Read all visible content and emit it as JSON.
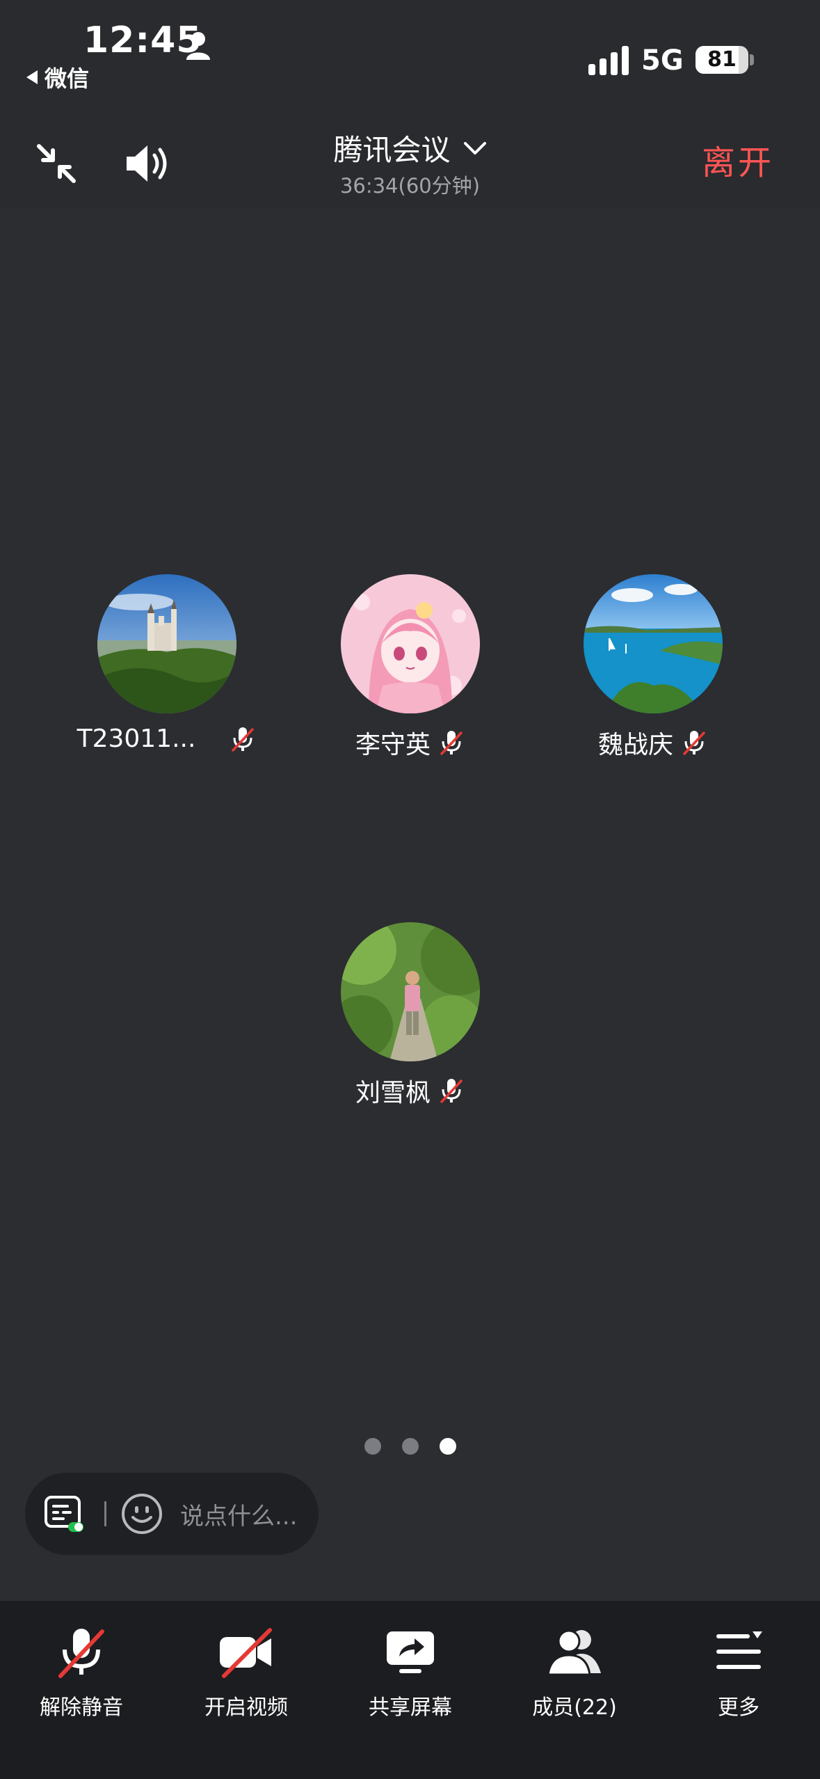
{
  "status_bar": {
    "time": "12:45",
    "back_label": "微信",
    "network": "5G",
    "battery": "81",
    "battery_level": 0.81
  },
  "header": {
    "title": "腾讯会议",
    "duration": "36:34(60分钟)",
    "leave_label": "离开"
  },
  "participants": [
    {
      "name": "T23011...",
      "mic": "off",
      "avatar": "castle-landscape"
    },
    {
      "name": "李守英",
      "mic": "off",
      "avatar": "anime-girl-pink"
    },
    {
      "name": "魏战庆",
      "mic": "off",
      "avatar": "sea-bay"
    },
    {
      "name": "刘雪枫",
      "mic": "off",
      "avatar": "person-in-forest"
    }
  ],
  "pager": {
    "count": 3,
    "active": 3
  },
  "chat": {
    "placeholder": "说点什么..."
  },
  "toolbar": {
    "items": [
      {
        "label": "解除静音",
        "icon": "mic-off-icon"
      },
      {
        "label": "开启视频",
        "icon": "video-off-icon"
      },
      {
        "label": "共享屏幕",
        "icon": "share-screen-icon"
      },
      {
        "label": "成员(22)",
        "icon": "members-icon"
      },
      {
        "label": "更多",
        "icon": "more-icon"
      }
    ]
  },
  "colors": {
    "background": "#2b2d31",
    "toolbar": "#1c1d20",
    "leave": "#ff5555",
    "mute_slash": "#e53935"
  }
}
